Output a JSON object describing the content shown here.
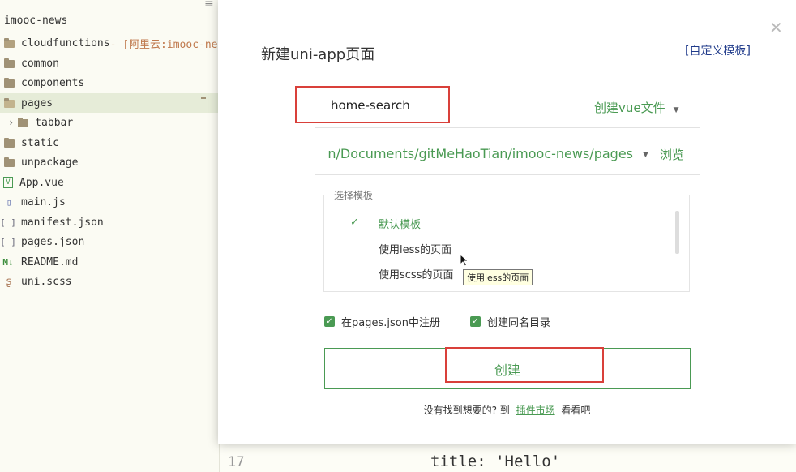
{
  "sidebar": {
    "project_title": "imooc-news",
    "items": [
      {
        "label": "cloudfunctions",
        "suffix": " - [阿里云:imooc-ne",
        "icon": "cloud-folder-icon"
      },
      {
        "label": "common",
        "icon": "folder-icon"
      },
      {
        "label": "components",
        "icon": "folder-icon"
      },
      {
        "label": "pages",
        "icon": "folder-open-icon"
      },
      {
        "label": "tabbar",
        "icon": "folder-icon"
      },
      {
        "label": "static",
        "icon": "folder-icon"
      },
      {
        "label": "unpackage",
        "icon": "folder-icon"
      },
      {
        "label": "App.vue",
        "icon": "vue-file-icon",
        "glyph": "V"
      },
      {
        "label": "main.js",
        "icon": "js-file-icon",
        "glyph": "▯"
      },
      {
        "label": "manifest.json",
        "icon": "json-file-icon",
        "glyph": "[ ]"
      },
      {
        "label": "pages.json",
        "icon": "json-file-icon",
        "glyph": "[ ]"
      },
      {
        "label": "README.md",
        "icon": "markdown-file-icon",
        "glyph": "M↓"
      },
      {
        "label": "uni.scss",
        "icon": "scss-file-icon",
        "glyph": "ʂ"
      }
    ]
  },
  "editor": {
    "line_number": "17",
    "code": {
      "key": "title",
      "colon": ": ",
      "value": "'Hello'"
    }
  },
  "dialog": {
    "title": "新建uni-app页面",
    "custom_template": "[自定义模板]",
    "page_name": "home-search",
    "file_type": "创建vue文件",
    "path": "n/Documents/gitMeHaoTian/imooc-news/pages",
    "browse": "浏览",
    "template_section": {
      "legend": "选择模板",
      "items": [
        {
          "label": "默认模板",
          "selected": true
        },
        {
          "label": "使用less的页面",
          "selected": false
        },
        {
          "label": "使用scss的页面",
          "selected": false
        }
      ],
      "tooltip": "使用less的页面"
    },
    "register_in_pages_json": {
      "label": "在pages.json中注册",
      "checked": true
    },
    "create_same_name_dir": {
      "label": "创建同名目录",
      "checked": true
    },
    "create_button": "创建",
    "footer": {
      "prefix": "没有找到想要的? 到",
      "market_link": "插件市场",
      "suffix": "看看吧"
    }
  },
  "colors": {
    "accent_green": "#4a9a53",
    "highlight_red": "#d9403a",
    "link_blue": "#1f3a8a"
  }
}
